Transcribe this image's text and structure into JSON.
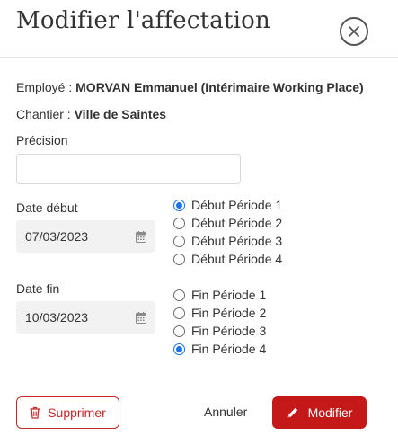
{
  "modal": {
    "title": "Modifier l'affectation"
  },
  "info": {
    "employe_label": "Employé : ",
    "employe_value": "MORVAN Emmanuel (Intérimaire Working Place)",
    "chantier_label": "Chantier : ",
    "chantier_value": "Ville de Saintes"
  },
  "form": {
    "precision_label": "Précision",
    "precision_value": "",
    "date_debut_label": "Date début",
    "date_debut_value": "07/03/2023",
    "date_fin_label": "Date fin",
    "date_fin_value": "10/03/2023"
  },
  "debut_periodes": [
    {
      "label": "Début Période 1",
      "checked": true
    },
    {
      "label": "Début Période 2",
      "checked": false
    },
    {
      "label": "Début Période 3",
      "checked": false
    },
    {
      "label": "Début Période 4",
      "checked": false
    }
  ],
  "fin_periodes": [
    {
      "label": "Fin Période 1",
      "checked": false
    },
    {
      "label": "Fin Période 2",
      "checked": false
    },
    {
      "label": "Fin Période 3",
      "checked": false
    },
    {
      "label": "Fin Période 4",
      "checked": true
    }
  ],
  "actions": {
    "delete_label": "Supprimer",
    "cancel_label": "Annuler",
    "modify_label": "Modifier"
  },
  "icons": {
    "close": "close-icon",
    "calendar": "calendar-icon",
    "trash": "trash-icon",
    "pencil": "pencil-icon"
  },
  "colors": {
    "danger": "#c51818",
    "radio_accent": "#1a73e8"
  }
}
